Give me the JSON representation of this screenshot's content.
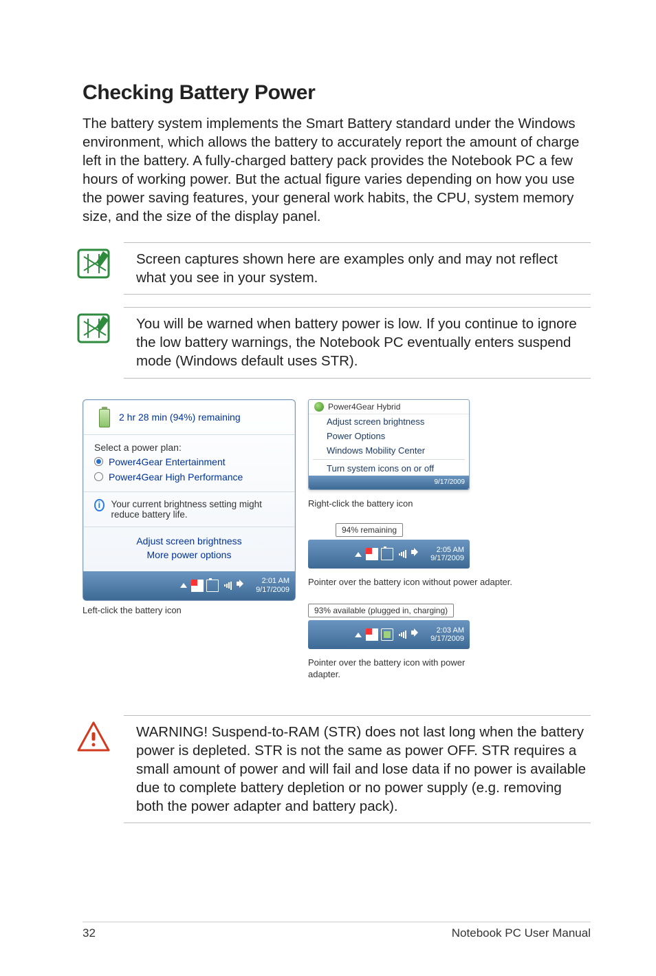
{
  "title": "Checking Battery Power",
  "intro": "The battery system implements the Smart Battery standard under the Windows environment, which allows the battery to accurately report the amount of charge left in the battery. A fully-charged battery pack provides the Notebook PC a few hours of working power. But the actual figure varies depending on how you use the power saving features, your general work habits, the CPU, system memory size, and the size of the display panel.",
  "note1": "Screen captures shown here are examples only and may not reflect what you see in your system.",
  "note2": "You will be warned when battery power is low. If you continue to ignore the low battery warnings, the Notebook PC eventually enters suspend mode (Windows default uses STR).",
  "popup": {
    "remaining": "2 hr 28 min (94%) remaining",
    "select_label": "Select a power plan:",
    "plan1": "Power4Gear Entertainment",
    "plan2": "Power4Gear High Performance",
    "bright_note": "Your current brightness setting might reduce battery life.",
    "link1": "Adjust screen brightness",
    "link2": "More power options"
  },
  "taskbar_left": {
    "time": "2:01 AM",
    "date": "9/17/2009"
  },
  "caption_left": "Left-click the battery icon",
  "ctx": {
    "title": "Power4Gear Hybrid",
    "i1": "Adjust screen brightness",
    "i2": "Power Options",
    "i3": "Windows Mobility Center",
    "i4": "Turn system icons on or off",
    "mini_date": "9/17/2009"
  },
  "caption_r1": "Right-click the battery icon",
  "tooltip1": "94% remaining",
  "taskbar_r1": {
    "time": "2:05 AM",
    "date": "9/17/2009"
  },
  "caption_r2": "Pointer over the battery icon without power adapter.",
  "tooltip2": "93% available (plugged in, charging)",
  "taskbar_r2": {
    "time": "2:03 AM",
    "date": "9/17/2009"
  },
  "caption_r3": "Pointer over the battery icon with power adapter.",
  "warning": "WARNING!  Suspend-to-RAM (STR) does not last long when the battery power is depleted. STR is not the same as power OFF. STR requires a small amount of power and will fail and lose data if no power is available due to complete battery depletion or no power supply (e.g. removing both the power adapter and battery pack).",
  "footer": {
    "page": "32",
    "doc": "Notebook PC User Manual"
  }
}
